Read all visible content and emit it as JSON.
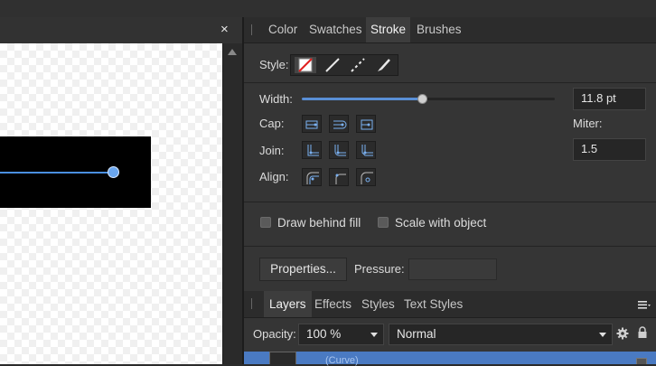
{
  "document": {
    "close_label": "×"
  },
  "panel": {
    "tabs": [
      {
        "label": "Color"
      },
      {
        "label": "Swatches"
      },
      {
        "label": "Stroke",
        "active": true
      },
      {
        "label": "Brushes"
      }
    ],
    "style_label": "Style:",
    "style_options": [
      {
        "icon": "no-stroke-icon",
        "selected": true
      },
      {
        "icon": "solid-line-icon"
      },
      {
        "icon": "dashed-line-icon"
      },
      {
        "icon": "brush-stroke-icon"
      }
    ],
    "width_label": "Width:",
    "width_value": "11.8 pt",
    "width_slider_fraction": 0.475,
    "cap_label": "Cap:",
    "cap_icons": [
      "butt-cap-icon",
      "round-cap-icon",
      "square-cap-icon"
    ],
    "miter_label": "Miter:",
    "miter_value": "1.5",
    "join_label": "Join:",
    "join_icons": [
      "miter-join-icon",
      "round-join-icon",
      "bevel-join-icon"
    ],
    "align_label": "Align:",
    "align_icons": [
      "align-inside-icon",
      "align-center-icon",
      "align-outside-icon"
    ],
    "draw_behind_fill_label": "Draw behind fill",
    "scale_with_object_label": "Scale with object",
    "properties_button": "Properties...",
    "pressure_label": "Pressure:"
  },
  "layers_panel": {
    "tabs": [
      {
        "label": "Layers",
        "active": true
      },
      {
        "label": "Effects"
      },
      {
        "label": "Styles"
      },
      {
        "label": "Text Styles"
      }
    ],
    "menu_icon": "hamburger-menu-icon",
    "opacity_label": "Opacity:",
    "opacity_value": "100 %",
    "blend_mode": "Normal",
    "gear_icon": "gear-icon",
    "lock_icon": "lock-icon",
    "layer_name": "(Curve)"
  },
  "colors": {
    "accent": "#5a8fd6",
    "selection_line": "#4a8fe0",
    "panel_bg": "#353535"
  }
}
